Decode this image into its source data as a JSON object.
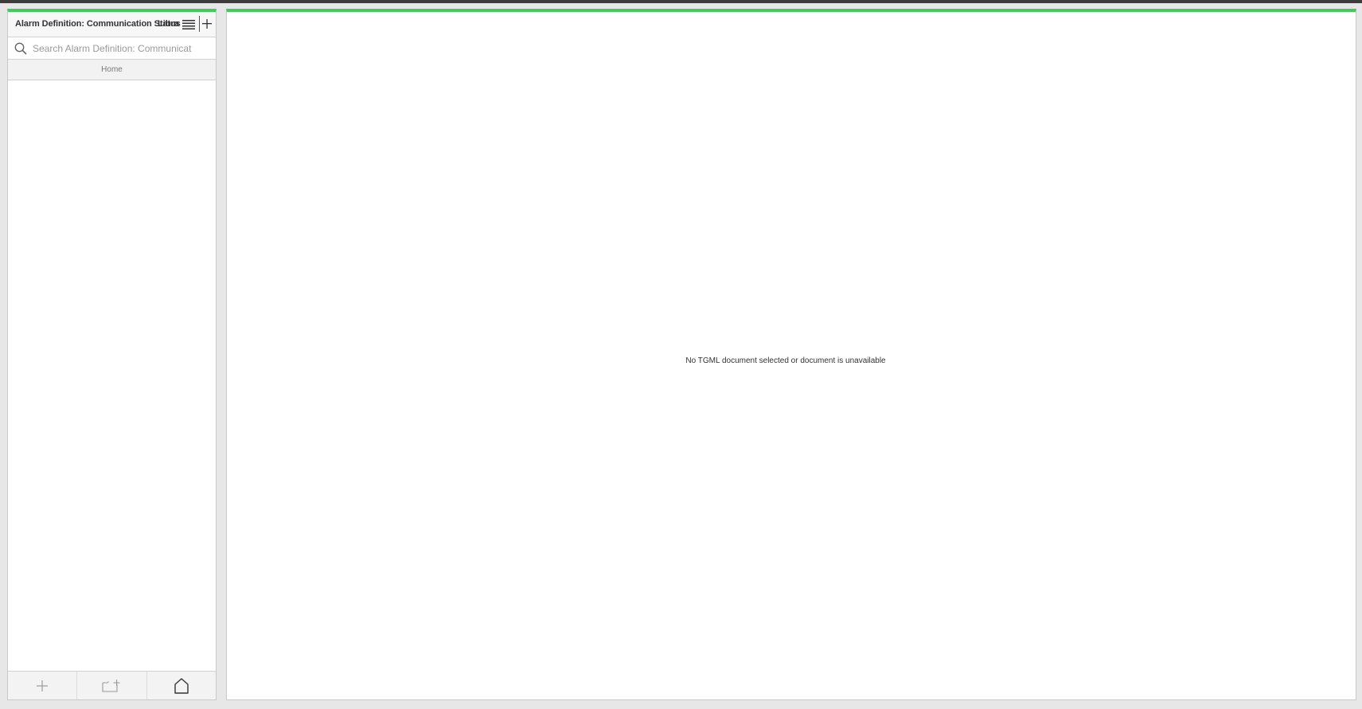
{
  "left_panel": {
    "title": "Alarm Definition: Communication Status",
    "title_overflow": "Libra",
    "menu_icon": "hamburger-menu-icon",
    "add_icon": "plus-icon",
    "search": {
      "placeholder": "Search Alarm Definition: Communicat",
      "value": "",
      "icon": "search-icon"
    },
    "breadcrumb": {
      "home_label": "Home"
    },
    "items": [],
    "footer": {
      "add_icon": "plus-icon",
      "new_folder_icon": "folder-add-icon",
      "home_icon": "home-icon"
    }
  },
  "main_panel": {
    "empty_message": "No TGML document selected or document is unavailable"
  },
  "colors": {
    "accent": "#3dcd58",
    "top_bar": "#3c3c3c",
    "background": "#e7e7e7"
  }
}
